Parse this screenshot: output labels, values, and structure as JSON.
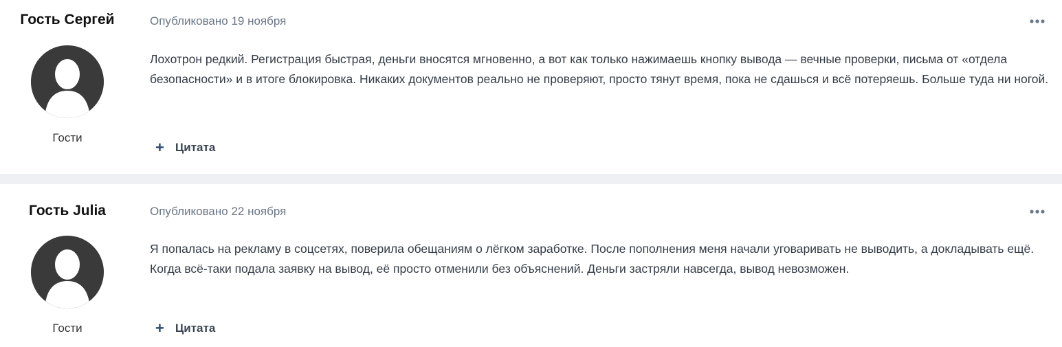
{
  "posts": [
    {
      "author": "Гость Сергей",
      "group": "Гости",
      "date": "Опубликовано 19 ноября",
      "body": "Лохотрон редкий. Регистрация быстрая, деньги вносятся мгновенно, а вот как только нажимаешь кнопку вывода — вечные проверки, письма от «отдела безопасности» и в итоге блокировка. Никаких документов реально не проверяют, просто тянут время, пока не сдашься и всё потеряешь. Больше туда ни ногой.",
      "quote_label": "Цитата"
    },
    {
      "author": "Гость Julia",
      "group": "Гости",
      "date": "Опубликовано 22 ноября",
      "body": "Я попалась на рекламу в соцсетях, поверила обещаниям о лёгком заработке. После пополнения меня начали уговаривать не выводить, а докладывать ещё. Когда всё-таки подала заявку на вывод, её просто отменили без объяснений. Деньги застряли навсегда, вывод невозможен.",
      "quote_label": "Цитата"
    }
  ],
  "icons": {
    "avatar": "default-user-silhouette-icon",
    "more": "more-options-icon",
    "quote": "plus-icon"
  },
  "colors": {
    "avatar_bg": "#3a3a3a",
    "divider": "#eef0f4",
    "meta_text": "#6b7686",
    "accent": "#2b4a6f"
  }
}
